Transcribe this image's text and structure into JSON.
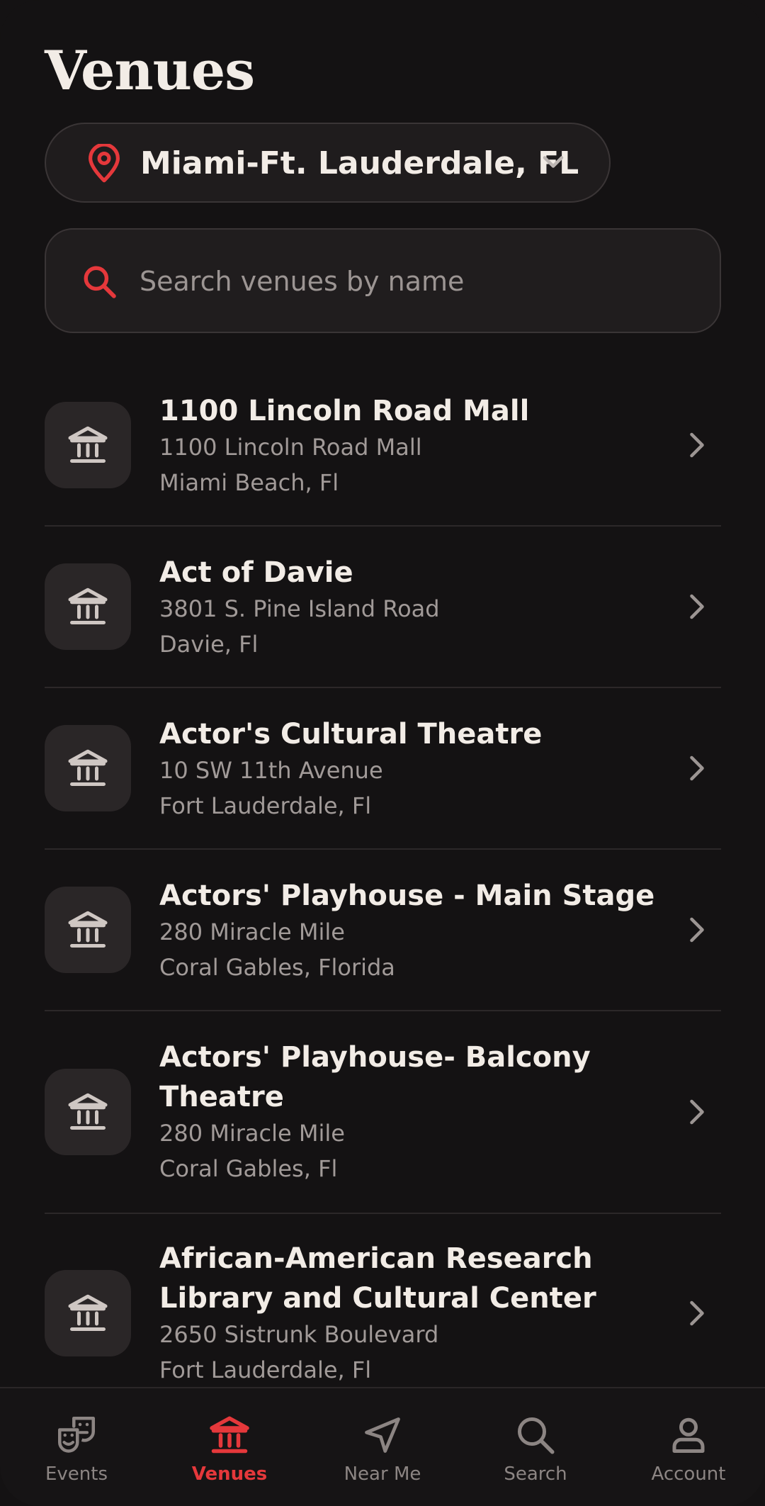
{
  "page": {
    "title": "Venues"
  },
  "location": {
    "label": "Miami-Ft. Lauderdale, FL",
    "icon": "map-pin-icon"
  },
  "search": {
    "placeholder": "Search venues by name",
    "value": ""
  },
  "venues": [
    {
      "name": "1100 Lincoln Road Mall",
      "address": "1100 Lincoln Road Mall",
      "city": "Miami Beach, Fl"
    },
    {
      "name": "Act of Davie",
      "address": "3801 S. Pine Island Road",
      "city": "Davie, Fl"
    },
    {
      "name": "Actor's Cultural Theatre",
      "address": "10 SW 11th Avenue",
      "city": "Fort Lauderdale, Fl"
    },
    {
      "name": "Actors' Playhouse - Main Stage",
      "address": "280 Miracle Mile",
      "city": "Coral Gables, Florida"
    },
    {
      "name": "Actors' Playhouse- Balcony\nTheatre",
      "address": "280 Miracle Mile",
      "city": "Coral Gables, Fl"
    },
    {
      "name": "African-American Research\nLibrary and Cultural Center",
      "address": "2650 Sistrunk Boulevard",
      "city": "Fort Lauderdale, Fl"
    }
  ],
  "tabs": [
    {
      "label": "Events",
      "icon": "theater-masks-icon",
      "active": false
    },
    {
      "label": "Venues",
      "icon": "venue-building-icon",
      "active": true
    },
    {
      "label": "Near Me",
      "icon": "navigation-arrow-icon",
      "active": false
    },
    {
      "label": "Search",
      "icon": "search-icon",
      "active": false
    },
    {
      "label": "Account",
      "icon": "user-icon",
      "active": false
    }
  ],
  "colors": {
    "accent": "#e5383b",
    "background": "#141213",
    "text": "#f2ece6",
    "muted": "#a19a98"
  }
}
